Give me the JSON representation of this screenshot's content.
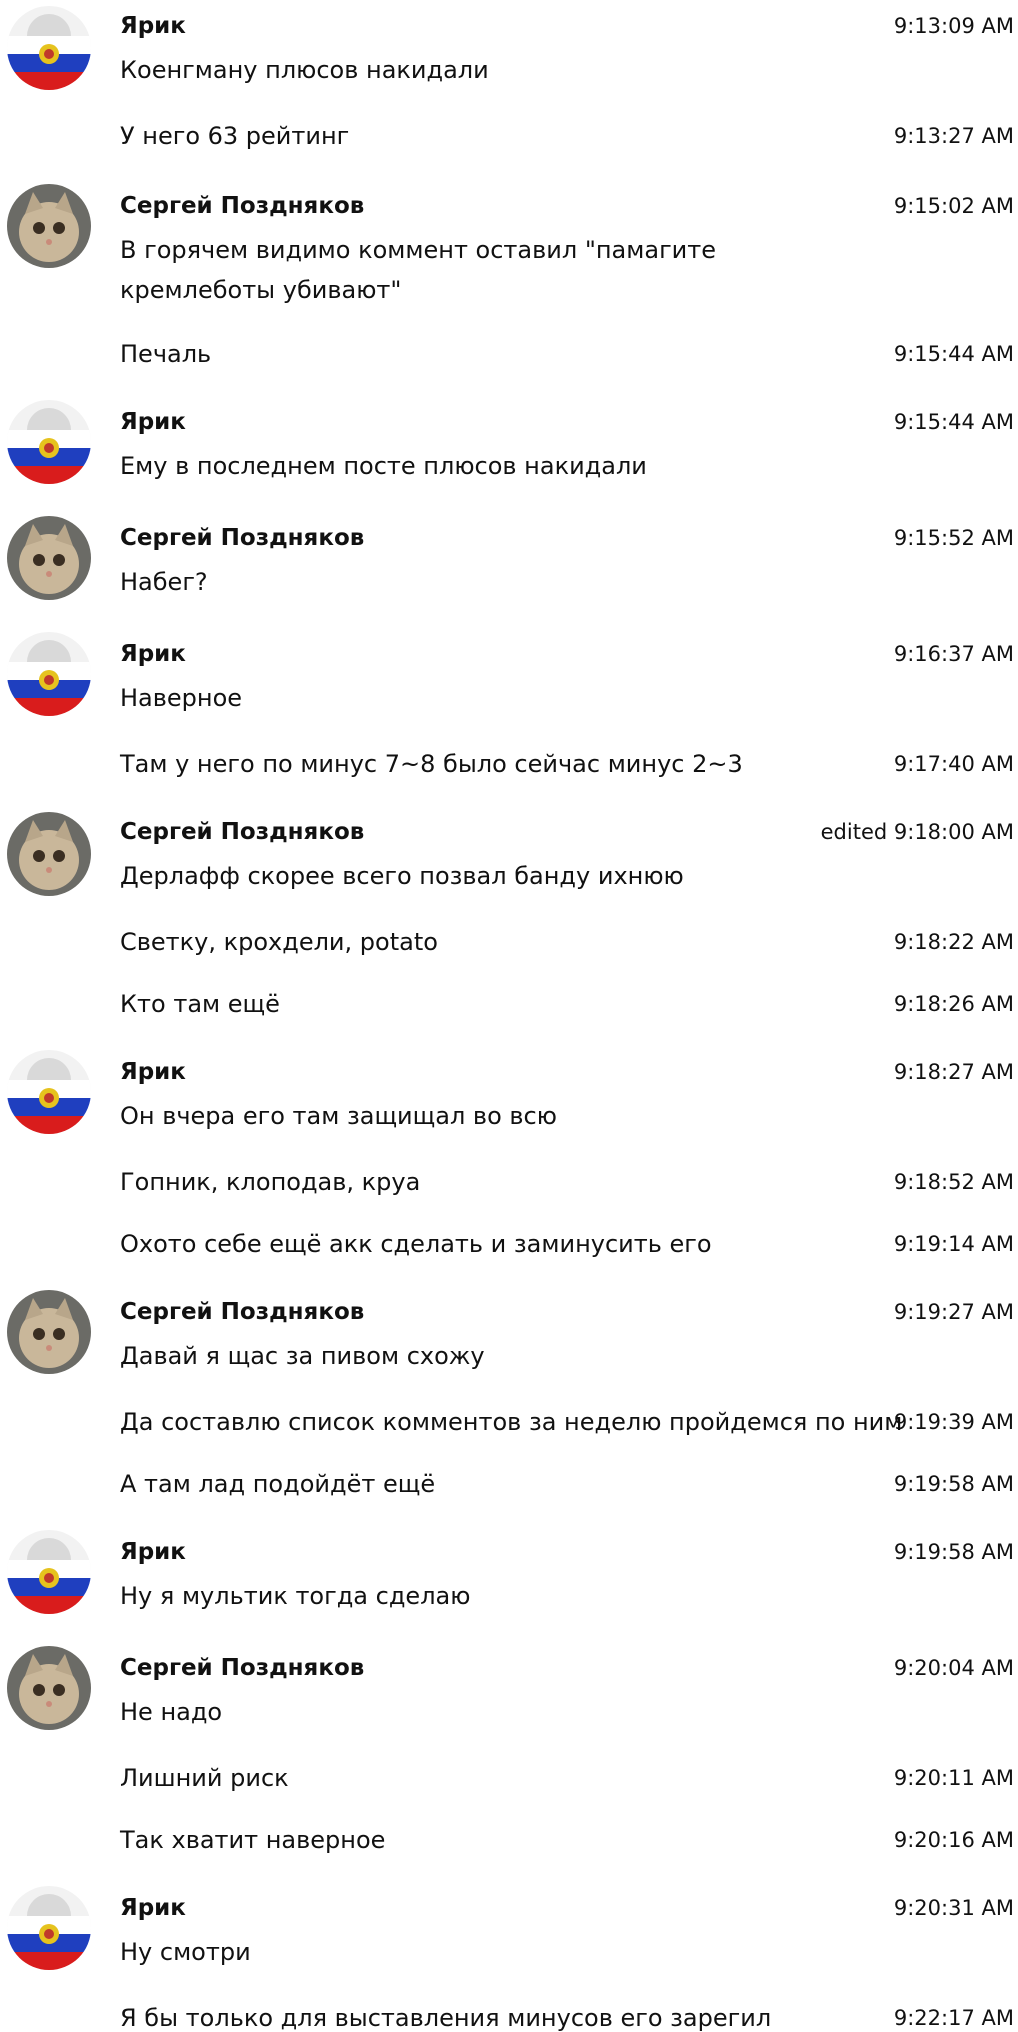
{
  "messages": [
    {
      "author": "Ярик",
      "avatar": "flag-avatar",
      "time": "9:13:09 AM",
      "text": "Коенгману плюсов накидали"
    },
    {
      "time": "9:13:27 AM",
      "text": "У него 63 рейтинг"
    },
    {
      "author": "Сергей Поздняков",
      "avatar": "cat-avatar",
      "time": "9:15:02 AM",
      "text": "В горячем видимо коммент оставил \"памагите кремлеботы убивают\""
    },
    {
      "time": "9:15:44 AM",
      "text": "Печаль"
    },
    {
      "author": "Ярик",
      "avatar": "flag-avatar",
      "time": "9:15:44 AM",
      "text": "Ему в последнем посте плюсов накидали"
    },
    {
      "author": "Сергей Поздняков",
      "avatar": "cat-avatar",
      "time": "9:15:52 AM",
      "text": "Набег?"
    },
    {
      "author": "Ярик",
      "avatar": "flag-avatar",
      "time": "9:16:37 AM",
      "text": "Наверное"
    },
    {
      "time": "9:17:40 AM",
      "text": "Там у него по минус 7~8 было сейчас минус 2~3"
    },
    {
      "author": "Сергей Поздняков",
      "avatar": "cat-avatar",
      "time": "edited 9:18:00 AM",
      "text": "Дерлафф скорее всего позвал банду ихнюю"
    },
    {
      "time": "9:18:22 AM",
      "text": "Светку, крохдели, potato"
    },
    {
      "time": "9:18:26 AM",
      "text": "Кто там ещё"
    },
    {
      "author": "Ярик",
      "avatar": "flag-avatar",
      "time": "9:18:27 AM",
      "text": "Он вчера его там защищал во всю"
    },
    {
      "time": "9:18:52 AM",
      "text": "Гопник, клоподав, круа"
    },
    {
      "time": "9:19:14 AM",
      "text": "Охото себе ещё акк сделать и заминусить его"
    },
    {
      "author": "Сергей Поздняков",
      "avatar": "cat-avatar",
      "time": "9:19:27 AM",
      "text": "Давай я щас за пивом схожу"
    },
    {
      "time": "9:19:39 AM",
      "text": "Да составлю список комментов за неделю пройдемся по ним"
    },
    {
      "time": "9:19:58 AM",
      "text": "А там лад подойдёт ещё"
    },
    {
      "author": "Ярик",
      "avatar": "flag-avatar",
      "time": "9:19:58 AM",
      "text": "Ну я мультик тогда сделаю"
    },
    {
      "author": "Сергей Поздняков",
      "avatar": "cat-avatar",
      "time": "9:20:04 AM",
      "text": "Не надо"
    },
    {
      "time": "9:20:11 AM",
      "text": "Лишний риск"
    },
    {
      "time": "9:20:16 AM",
      "text": "Так хватит наверное"
    },
    {
      "author": "Ярик",
      "avatar": "flag-avatar",
      "time": "9:20:31 AM",
      "text": "Ну смотри"
    },
    {
      "time": "9:22:17 AM",
      "text": "Я бы только для выставления минусов его зарегил"
    }
  ]
}
